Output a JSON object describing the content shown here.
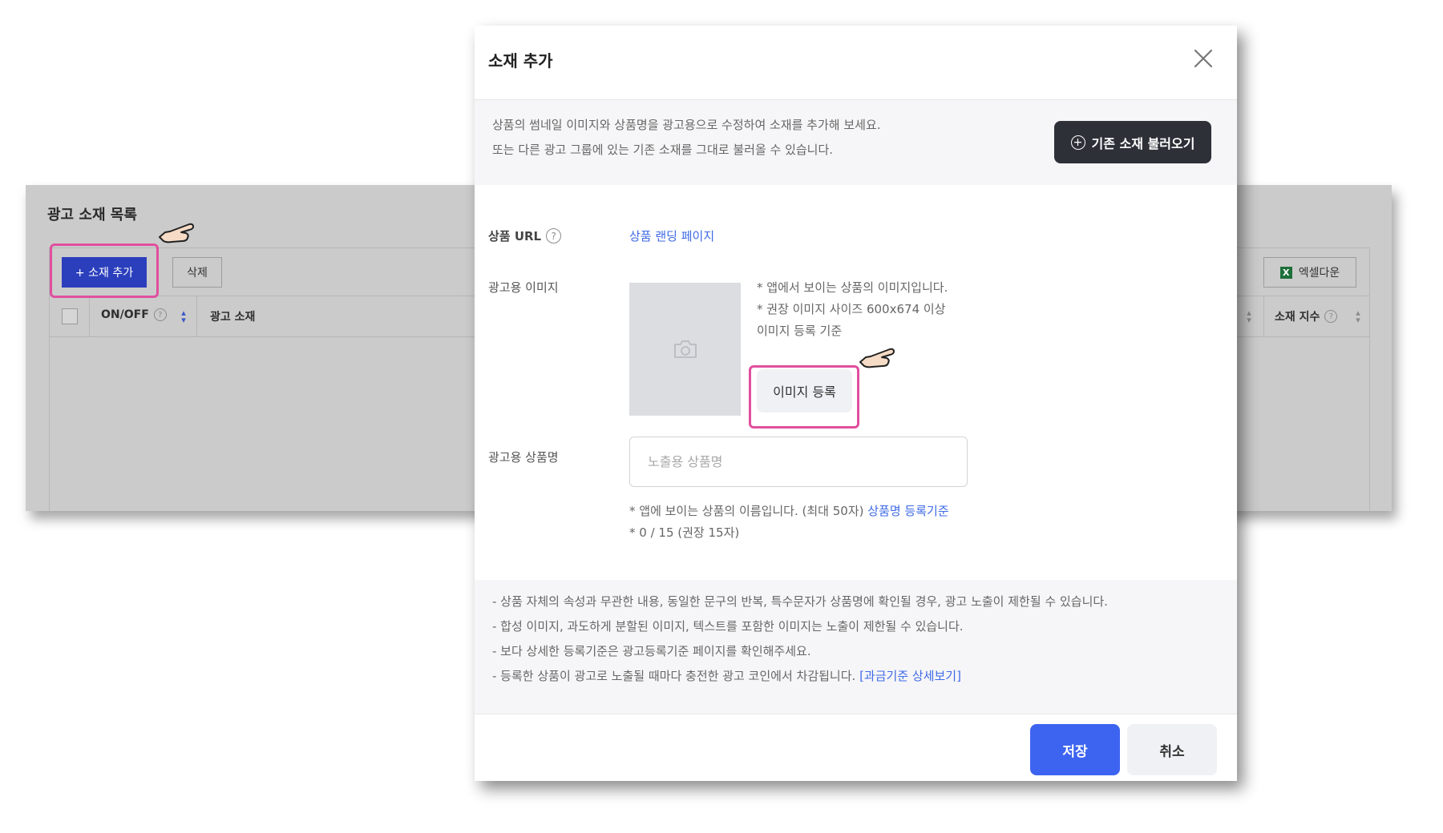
{
  "background_page": {
    "title": "광고 소재 목록",
    "add_button": "+ 소재 추가",
    "delete_button": "삭제",
    "excel_button": "엑셀다운",
    "excel_icon_glyph": "X",
    "columns": {
      "onoff": "ON/OFF",
      "creative": "광고 소재",
      "index": "소재 지수"
    }
  },
  "modal": {
    "title": "소재 추가",
    "intro_line1": "상품의 썸네일 이미지와 상품명을 광고용으로 수정하여 소재를 추가해 보세요.",
    "intro_line2": "또는 다른 광고 그룹에 있는 기존 소재를 그대로 불러올 수 있습니다.",
    "load_button": "기존 소재 불러오기",
    "url_label": "상품 URL",
    "url_link": "상품 랜딩 페이지",
    "image_label": "광고용 이미지",
    "image_note1": "* 앱에서 보이는 상품의 이미지입니다.",
    "image_note2": "* 권장 이미지 사이즈 600x674 이상",
    "image_guide_link": "이미지 등록 기준",
    "image_register_button": "이미지 등록",
    "name_label": "광고용 상품명",
    "name_placeholder": "노출용 상품명",
    "name_note_prefix": "* 앱에 보이는 상품의 이름입니다. (최대 50자)",
    "name_note_link": "상품명 등록기준",
    "name_counter": "* 0 / 15 (권장 15자)",
    "notices": [
      "- 상품 자체의 속성과 무관한 내용, 동일한 문구의 반복, 특수문자가 상품명에 확인될 경우, 광고 노출이 제한될 수 있습니다.",
      "- 합성 이미지, 과도하게 분할된 이미지, 텍스트를 포함한 이미지는 노출이 제한될 수 있습니다.",
      "- 보다 상세한 등록기준은 광고등록기준 페이지를 확인해주세요.",
      "- 등록한 상품이 광고로 노출될 때마다 충전한 광고 코인에서 차감됩니다."
    ],
    "billing_link": "[과금기준 상세보기]",
    "save_button": "저장",
    "cancel_button": "취소"
  },
  "colors": {
    "accent_blue": "#3d64f0",
    "highlight_pink": "#e04f9e",
    "dark_button": "#2e3038"
  },
  "icons": [
    "close-icon",
    "help-icon",
    "plus-circle-icon",
    "camera-icon",
    "excel-icon",
    "sort-icon",
    "pointing-hand-icon"
  ]
}
